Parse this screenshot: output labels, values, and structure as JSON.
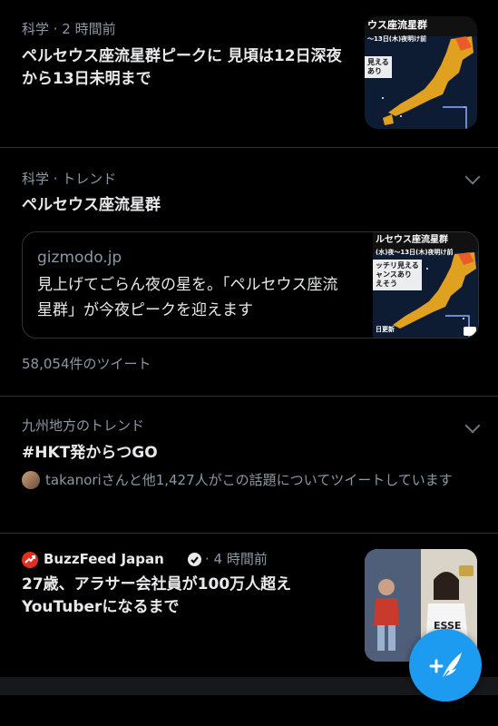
{
  "item1": {
    "meta": "科学 · 2 時間前",
    "title": "ペルセウス座流星群ピークに 見頃は12日深夜から13日未明まで",
    "thumb_header": "ウス座流星群",
    "thumb_sub": "～13日(木)夜明け前",
    "thumb_caption1": "見える",
    "thumb_caption2": "あり",
    "thumb_icon": "japan-map-thumbnail"
  },
  "item2": {
    "meta": "科学 · トレンド",
    "title": "ペルセウス座流星群",
    "card_domain": "gizmodo.jp",
    "card_text": "見上げてごらん夜の星を。「ペルセウス座流星群」が今夜ピークを迎えます",
    "thumb_header": "ルセウス座流星群",
    "thumb_sub": "(水)夜～13日(木)夜明け前",
    "thumb_caption1": "ッチリ見える",
    "thumb_caption2": "ャンスあり",
    "thumb_caption3": "えそう",
    "thumb_footer": "日更新",
    "tweet_count": "58,054件のツイート"
  },
  "item3": {
    "meta": "九州地方のトレンド",
    "title": "#HKT発からつGO",
    "social": "takanoriさんと他1,427人がこの話題についてツイートしています"
  },
  "item4": {
    "source": "BuzzFeed Japan",
    "time": " · 4 時間前",
    "title": "27歳、アラサー会社員が100万人超えYouTuberになるまで",
    "thumb_text": "ESSE"
  },
  "fab": {
    "icon": "compose-tweet-icon",
    "color": "#1d9bf0"
  },
  "colors": {
    "background": "#000000",
    "text": "#e7e9ea",
    "secondary": "#8b98a5",
    "divider": "#2f3336",
    "accent": "#1d9bf0"
  }
}
